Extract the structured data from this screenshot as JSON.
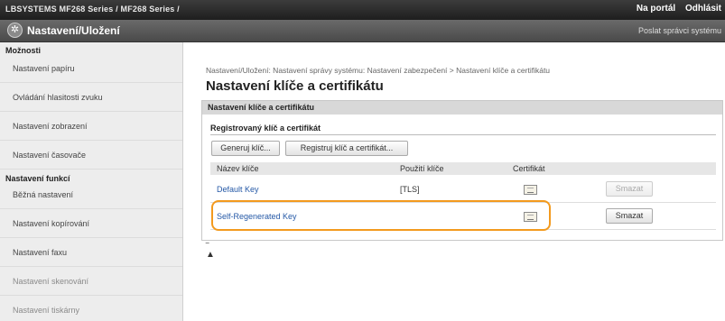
{
  "topbar": {
    "title": "LBSYSTEMS  MF268 Series / MF268 Series /",
    "links": [
      "Na portál",
      "Odhlásit"
    ]
  },
  "header": {
    "app_title": "Nastavení/Uložení",
    "admin_link": "Poslat správci systému"
  },
  "sidebar": {
    "group1": {
      "heading": "Možnosti",
      "items": [
        "Nastavení papíru",
        "Ovládání hlasitosti zvuku",
        "Nastavení zobrazení",
        "Nastavení časovače"
      ]
    },
    "group2": {
      "heading": "Nastavení funkcí",
      "items": [
        "Běžná nastavení",
        "Nastavení kopírování",
        "Nastavení faxu",
        "Nastavení skenování",
        "Nastavení tiskárny"
      ]
    }
  },
  "main": {
    "breadcrumb": "Nastavení/Uložení: Nastavení správy systému: Nastavení zabezpečení > Nastavení klíče a certifikátu",
    "title": "Nastavení klíče a certifikátu",
    "panel": {
      "heading": "Nastavení klíče a certifikátu",
      "subheading": "Registrovaný klíč a certifikát",
      "buttons": {
        "generate": "Generuj klíč...",
        "register": "Registruj klíč a certifikát..."
      },
      "columns": [
        "Název klíče",
        "Použití klíče",
        "Certifikát"
      ],
      "rows": [
        {
          "name": "Default Key",
          "usage": "[TLS]",
          "delete": "Smazat",
          "delete_enabled": false
        },
        {
          "name": "Self-Regenerated Key",
          "usage": "",
          "delete": "Smazat",
          "delete_enabled": true
        }
      ]
    },
    "top_icon": "go-to-top-icon"
  },
  "colors": {
    "highlight": "#f39a1e",
    "link": "#2458a6"
  }
}
